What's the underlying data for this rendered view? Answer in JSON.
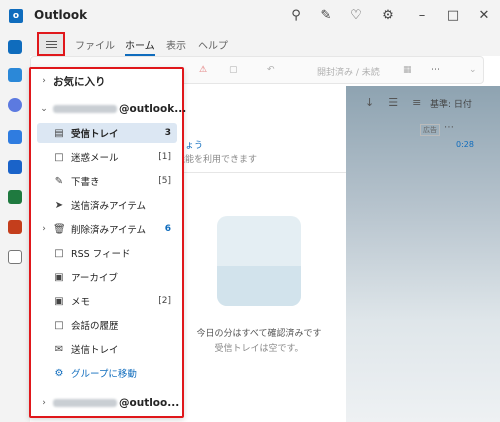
{
  "app": {
    "title": "Outlook"
  },
  "titlebar": {
    "icons": [
      "search-icon",
      "notes-icon",
      "bell-icon",
      "gear-icon",
      "minimize-icon",
      "maximize-icon",
      "close-icon"
    ]
  },
  "ribbon_tabs": [
    {
      "label": "ファイル",
      "active": false
    },
    {
      "label": "ホーム",
      "active": true
    },
    {
      "label": "表示",
      "active": false
    },
    {
      "label": "ヘルプ",
      "active": false
    }
  ],
  "ribbon": {
    "mark_read": "開封済み / 未読"
  },
  "folder_pane": {
    "favorites": {
      "label": "お気に入り"
    },
    "account1": {
      "suffix": "@outlook..."
    },
    "folders": [
      {
        "label": "受信トレイ",
        "count": "3",
        "icon": "inbox-icon",
        "selected": true
      },
      {
        "label": "迷惑メール",
        "count": "[1]",
        "icon": "junk-icon"
      },
      {
        "label": "下書き",
        "count": "[5]",
        "icon": "drafts-icon"
      },
      {
        "label": "送信済みアイテム",
        "count": "",
        "icon": "sent-icon"
      },
      {
        "label": "削除済みアイテム",
        "count": "6",
        "icon": "trash-icon",
        "expandable": true
      },
      {
        "label": "RSS フィード",
        "count": "",
        "icon": "folder-icon"
      },
      {
        "label": "アーカイブ",
        "count": "",
        "icon": "archive-icon"
      },
      {
        "label": "メモ",
        "count": "[2]",
        "icon": "note-icon"
      },
      {
        "label": "会話の履歴",
        "count": "",
        "icon": "folder-icon"
      },
      {
        "label": "送信トレイ",
        "count": "",
        "icon": "outbox-icon"
      }
    ],
    "groups_link": "グループに移動",
    "account2": {
      "suffix": "@outloo..."
    }
  },
  "message_list": {
    "sort_label": "基準: 日付",
    "ad_badge": "広告",
    "ad_line1": "しょう",
    "ad_line2": "機能を利用できます",
    "ad_time": "0:28",
    "empty_title": "今日の分はすべて確認済みです",
    "empty_subtitle": "受信トレイは空です。"
  }
}
